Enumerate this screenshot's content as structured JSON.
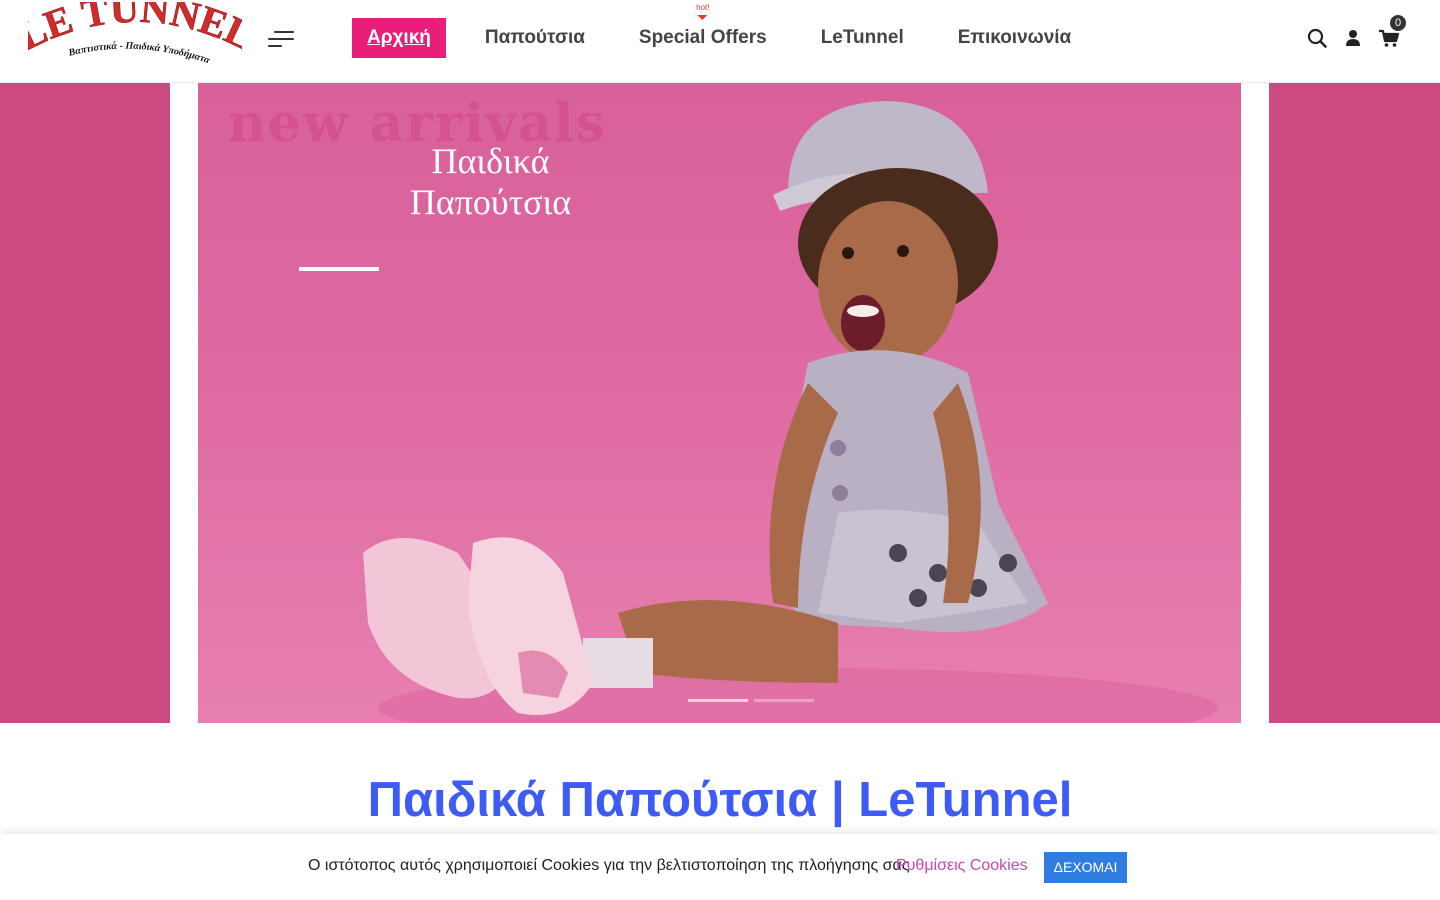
{
  "brand": {
    "logo_text": "LE TUNNEL",
    "logo_tagline": "Βαπτιστικά - Παιδικά Υποδήματα",
    "colors": {
      "logo_red": "#d12c2c",
      "accent_pink": "#e91e7a",
      "title_blue": "#3d5bf5"
    }
  },
  "nav": {
    "items": [
      {
        "label": "Αρχική",
        "active": true
      },
      {
        "label": "Παπούτσια",
        "active": false
      },
      {
        "label": "Special Offers",
        "active": false,
        "badge": "hot!"
      },
      {
        "label": "LeTunnel",
        "active": false
      },
      {
        "label": "Επικοινωνία",
        "active": false
      }
    ]
  },
  "header_icons": {
    "search": "search-icon",
    "account": "user-icon",
    "cart": "cart-icon",
    "cart_count": "0"
  },
  "slider": {
    "background_text": "new arrivals",
    "heading": "Παιδικά Παπούτσια",
    "active_slide": 1,
    "slide_count": 2
  },
  "page": {
    "title": "Παιδικά Παπούτσια | LeTunnel"
  },
  "cookie_bar": {
    "message": "Ο ιστότοπος αυτός χρησιμοποιεί Cookies για την βελτιστοποίηση της πλοήγησης σας",
    "settings_label": "Ρυθμίσεις Cookies",
    "accept_label": "ΔΕΧΟΜΑΙ"
  }
}
